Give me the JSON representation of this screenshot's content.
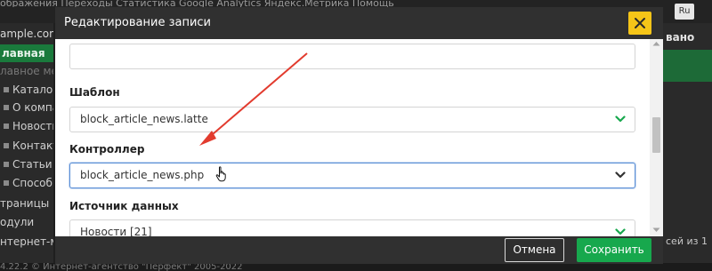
{
  "background": {
    "top_link": "ображения   Переходы   Статистика   Google Analytics   Яндекс.Метрика   Помощь",
    "domain": "ample.com",
    "active_item": "лавная",
    "main_menu_label": "лавное мен",
    "sidebar_items": [
      "Каталог",
      "О компа",
      "Новости",
      "Контакты",
      "Статьи",
      "Способы"
    ],
    "extra_items": [
      "траницы",
      "одули",
      "нтернет-м"
    ],
    "footer": "4.22.2 © Интернет-агентство \"Перфект\" 2005-2022",
    "right_button": "Ru",
    "right_header": "вано",
    "right_pagination": "сей из 1"
  },
  "modal": {
    "title": "Редактирование записи",
    "close_icon": "close-icon",
    "fields": {
      "template_label": "Шаблон",
      "template_value": "block_article_news.latte",
      "controller_label": "Контроллер",
      "controller_value": "block_article_news.php",
      "data_source_label": "Источник данных",
      "data_source_value": "Новости [21]"
    },
    "buttons": {
      "cancel": "Отмена",
      "save": "Сохранить"
    }
  },
  "colors": {
    "accent_green": "#17a84d",
    "close_yellow": "#f5c518",
    "annotation_arrow": "#e23b2e",
    "header_dark": "#303030"
  }
}
